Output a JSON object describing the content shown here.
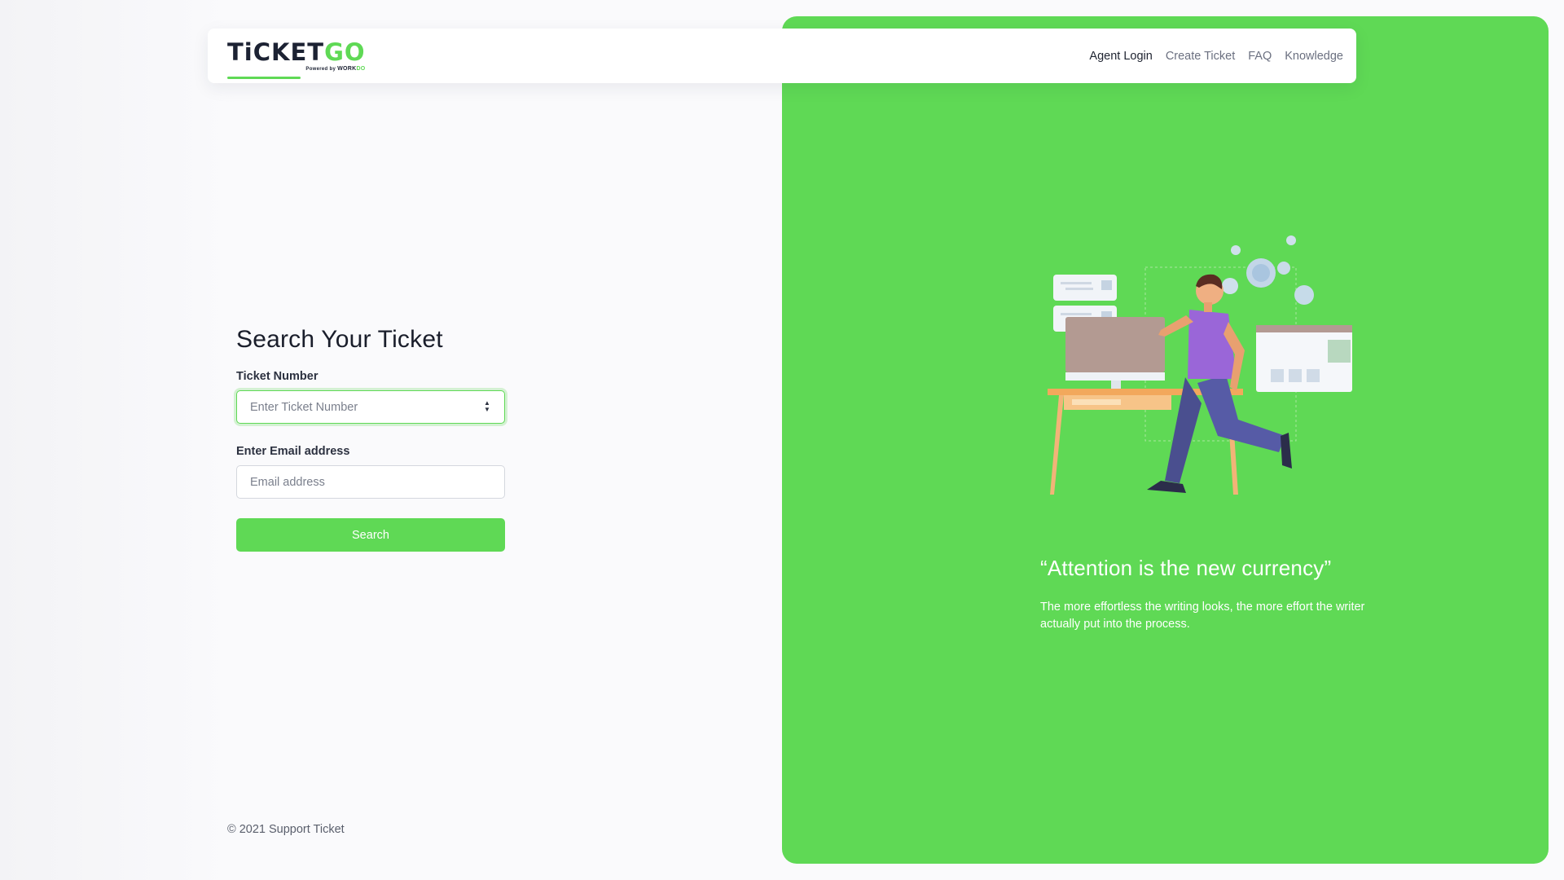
{
  "brand": {
    "logo_main": "TiCKET",
    "logo_accent": "GO",
    "powered_prefix": "Powered by",
    "powered_brand": "WORK",
    "powered_brand_accent": "DO"
  },
  "nav": {
    "items": [
      {
        "label": "Agent Login",
        "active": true
      },
      {
        "label": "Create Ticket",
        "active": false
      },
      {
        "label": "FAQ",
        "active": false
      },
      {
        "label": "Knowledge",
        "active": false
      }
    ]
  },
  "form": {
    "title": "Search Your Ticket",
    "ticket_label": "Ticket Number",
    "ticket_placeholder": "Enter Ticket Number",
    "ticket_value": "",
    "email_label": "Enter Email address",
    "email_placeholder": "Email address",
    "email_value": "",
    "submit_label": "Search"
  },
  "footer": {
    "copyright": "© 2021 Support Ticket"
  },
  "promo": {
    "quote_title": "“Attention is the new currency”",
    "quote_text": "The more effortless the writing looks, the more effort the writer actually put into the process."
  },
  "colors": {
    "accent": "#5fd955",
    "text_dark": "#1e2330",
    "text_muted": "#6b7080",
    "background": "#fafafc"
  },
  "icons": {
    "spinner": "number-spinner-icon",
    "illustration": "running-man-desk-illustration"
  }
}
